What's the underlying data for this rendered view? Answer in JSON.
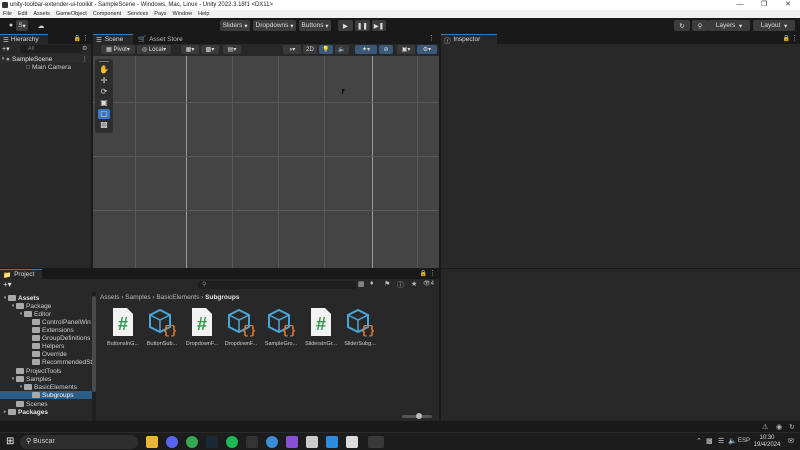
{
  "window": {
    "title": "unity-toolbar-extender-ui-toolkit - SampleScene - Windows, Mac, Linux - Unity 2022.3.18f1 <DX11>",
    "controls": [
      "—",
      "❐",
      "✕"
    ]
  },
  "menu": [
    "File",
    "Edit",
    "Assets",
    "GameObject",
    "Component",
    "Services",
    "Pays",
    "Window",
    "Help"
  ],
  "toolbar": {
    "sliders": "Sliders",
    "dropdowns": "Dropdowns",
    "buttons": "Buttons",
    "account_initial": "S",
    "layers": "Layers",
    "layout": "Layout"
  },
  "hierarchy": {
    "tab": "Hierarchy",
    "search_placeholder": "All",
    "scene": "SampleScene",
    "camera": "Main Camera"
  },
  "scene": {
    "tab_scene": "Scene",
    "tab_asset_store": "Asset Store",
    "pivot": "Pivot",
    "local": "Local",
    "mode_2d": "2D"
  },
  "inspector": {
    "tab": "Inspector"
  },
  "project": {
    "tab": "Project",
    "badge_count": "4",
    "tree": [
      {
        "label": "Assets",
        "level": 0,
        "bold": true
      },
      {
        "label": "Package",
        "level": 1
      },
      {
        "label": "Editor",
        "level": 2
      },
      {
        "label": "ControlPanelWin",
        "level": 3
      },
      {
        "label": "Extensions",
        "level": 3
      },
      {
        "label": "GroupDefinitions",
        "level": 3
      },
      {
        "label": "Helpers",
        "level": 3
      },
      {
        "label": "Override",
        "level": 3
      },
      {
        "label": "RecommendedSt",
        "level": 3
      },
      {
        "label": "ProjectTools",
        "level": 1
      },
      {
        "label": "Samples",
        "level": 1
      },
      {
        "label": "BasicElements",
        "level": 2
      },
      {
        "label": "Subgroups",
        "level": 3
      },
      {
        "label": "Scenes",
        "level": 1
      },
      {
        "label": "Packages",
        "level": 0,
        "bold": true
      }
    ],
    "breadcrumb": [
      "Assets",
      "Samples",
      "BasicElements",
      "Subgroups"
    ],
    "assets": [
      {
        "label": "ButtonsInG...",
        "kind": "script"
      },
      {
        "label": "ButtonSub...",
        "kind": "uxml"
      },
      {
        "label": "DropdownF...",
        "kind": "script"
      },
      {
        "label": "DropdownF...",
        "kind": "uxml"
      },
      {
        "label": "SampleGro...",
        "kind": "uxml"
      },
      {
        "label": "SlidersInGr...",
        "kind": "script"
      },
      {
        "label": "SliderSubg...",
        "kind": "uxml"
      }
    ]
  },
  "taskbar": {
    "search": "Buscar",
    "lang": "ESP",
    "time": "10:30",
    "date": "19/4/2024"
  },
  "colors": {
    "accent": "#3a79bb",
    "script_green": "#2e9a4a",
    "uxml_blue": "#4aa6d8",
    "uxml_orange": "#e07a2e"
  }
}
